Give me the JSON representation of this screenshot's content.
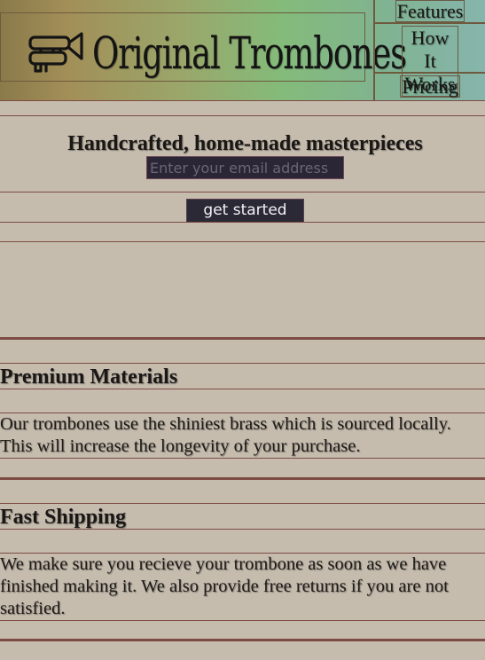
{
  "header": {
    "brand": "Original Trombones",
    "logo_icon": "trombone-icon",
    "nav": [
      {
        "label": "Features"
      },
      {
        "label": "How It Works"
      },
      {
        "label": "Pricing"
      }
    ]
  },
  "hero": {
    "title": "Handcrafted, home-made masterpieces",
    "email_placeholder": "Enter your email address",
    "submit_label": "get started"
  },
  "features": [
    {
      "title": "Premium Materials",
      "body": "Our trombones use the shiniest brass which is sourced locally. This will increase the longevity of your purchase."
    },
    {
      "title": "Fast Shipping",
      "body": "We make sure you recieve your trombone as soon as we have finished making it. We also provide free returns if you are not satisfied."
    }
  ],
  "colors": {
    "page_background": "#c5bcae",
    "rule": "#7d4b43",
    "button_background": "#2c2936"
  }
}
